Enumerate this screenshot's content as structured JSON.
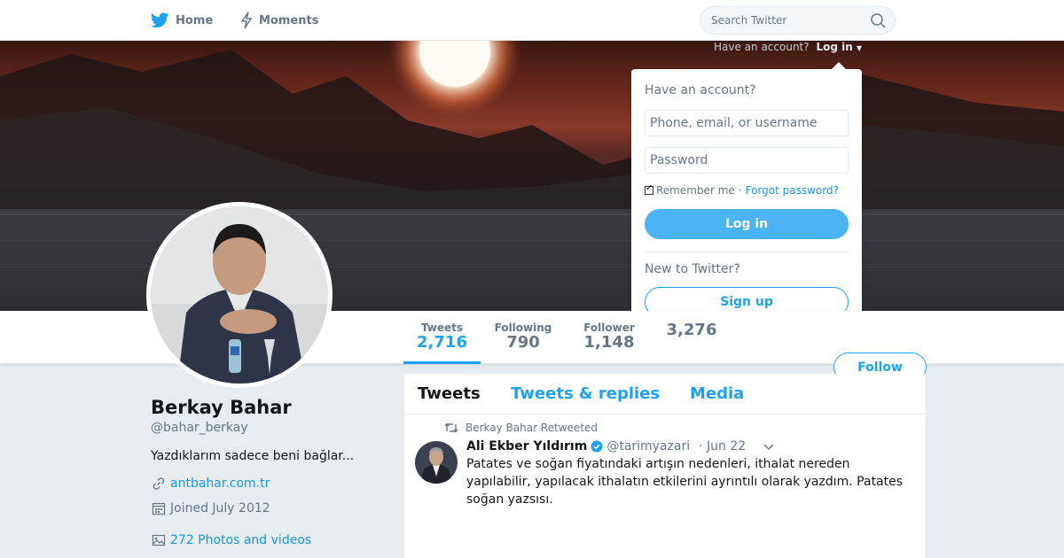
{
  "nav": {
    "home_label": "Home",
    "moments_label": "Moments",
    "search_placeholder": "Search Twitter"
  },
  "account_prompt": {
    "text": "Have an account?",
    "login_label": "Log in"
  },
  "login_dropdown": {
    "heading": "Have an account?",
    "username_placeholder": "Phone, email, or username",
    "password_placeholder": "Password",
    "remember_label": "Remember me",
    "separator": "·",
    "forgot_label": "Forgot password?",
    "login_button": "Log in",
    "new_heading": "New to Twitter?",
    "signup_button": "Sign up"
  },
  "stats": [
    {
      "label": "Tweets",
      "value": "2,716"
    },
    {
      "label": "Following",
      "value": "790"
    },
    {
      "label": "Follower",
      "value": "1,148"
    },
    {
      "label": "",
      "value": "3,276"
    }
  ],
  "follow_button": "Follow",
  "profile": {
    "name": "Berkay Bahar",
    "handle": "@bahar_berkay",
    "bio": "Yazdıklarım sadece beni bağlar...",
    "website": "antbahar.com.tr",
    "joined": "Joined July 2012",
    "photos": "272 Photos and videos"
  },
  "timeline": {
    "tabs": [
      "Tweets",
      "Tweets & replies",
      "Media"
    ],
    "retweet_label": "Berkay Bahar Retweeted",
    "tweet": {
      "name": "Ali Ekber Yıldırım",
      "handle": "@tarimyazari",
      "time": "· Jun 22",
      "text": "Patates ve soğan fiyatındaki artışın nedenleri, ithalat nereden yapılabilir, yapılacak ithalatın etkilerini ayrıntılı olarak yazdım. Patates soğan yazsısı."
    }
  },
  "colors": {
    "accent": "#1da1f2",
    "login_button_bg": "#4ab3f4",
    "page_bg": "#e6ecf0"
  },
  "icons": [
    "twitter-bird-icon",
    "moments-icon",
    "search-icon",
    "link-icon",
    "calendar-icon",
    "photos-icon",
    "retweet-icon",
    "verified-icon",
    "chevron-down-icon"
  ]
}
